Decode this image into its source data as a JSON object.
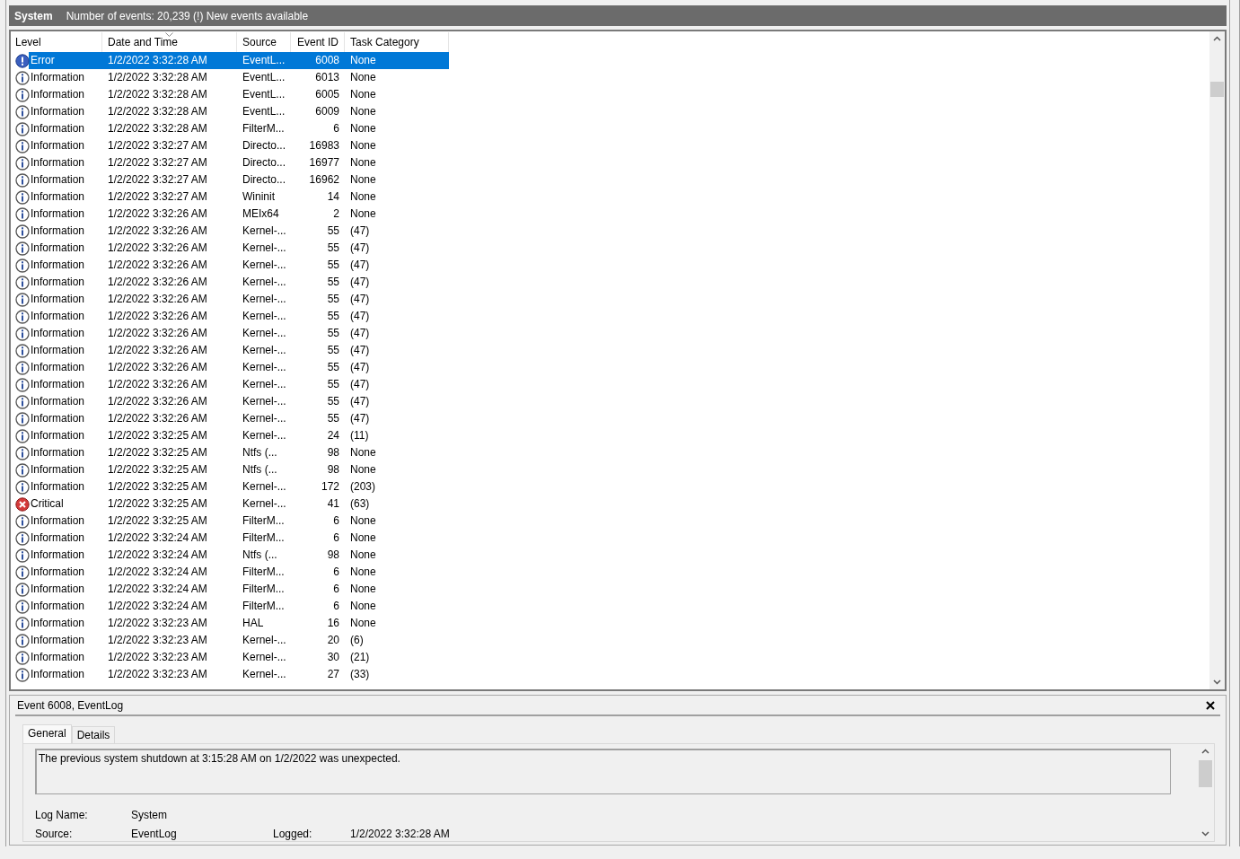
{
  "log_header": {
    "title": "System",
    "info": "Number of events: 20,239 (!) New events available"
  },
  "table": {
    "columns": [
      {
        "label": "Level",
        "sorted": false
      },
      {
        "label": "Date and Time",
        "sorted": true
      },
      {
        "label": "Source",
        "sorted": false
      },
      {
        "label": "Event ID",
        "sorted": false
      },
      {
        "label": "Task Category",
        "sorted": false
      }
    ],
    "rows": [
      {
        "kind": "error",
        "level": "Error",
        "date": "1/2/2022 3:32:28 AM",
        "source": "EventL...",
        "event_id": "6008",
        "category": "None",
        "selected": true
      },
      {
        "kind": "information",
        "level": "Information",
        "date": "1/2/2022 3:32:28 AM",
        "source": "EventL...",
        "event_id": "6013",
        "category": "None",
        "selected": false
      },
      {
        "kind": "information",
        "level": "Information",
        "date": "1/2/2022 3:32:28 AM",
        "source": "EventL...",
        "event_id": "6005",
        "category": "None",
        "selected": false
      },
      {
        "kind": "information",
        "level": "Information",
        "date": "1/2/2022 3:32:28 AM",
        "source": "EventL...",
        "event_id": "6009",
        "category": "None",
        "selected": false
      },
      {
        "kind": "information",
        "level": "Information",
        "date": "1/2/2022 3:32:28 AM",
        "source": "FilterM...",
        "event_id": "6",
        "category": "None",
        "selected": false
      },
      {
        "kind": "information",
        "level": "Information",
        "date": "1/2/2022 3:32:27 AM",
        "source": "Directo...",
        "event_id": "16983",
        "category": "None",
        "selected": false
      },
      {
        "kind": "information",
        "level": "Information",
        "date": "1/2/2022 3:32:27 AM",
        "source": "Directo...",
        "event_id": "16977",
        "category": "None",
        "selected": false
      },
      {
        "kind": "information",
        "level": "Information",
        "date": "1/2/2022 3:32:27 AM",
        "source": "Directo...",
        "event_id": "16962",
        "category": "None",
        "selected": false
      },
      {
        "kind": "information",
        "level": "Information",
        "date": "1/2/2022 3:32:27 AM",
        "source": "Wininit",
        "event_id": "14",
        "category": "None",
        "selected": false
      },
      {
        "kind": "information",
        "level": "Information",
        "date": "1/2/2022 3:32:26 AM",
        "source": "MEIx64",
        "event_id": "2",
        "category": "None",
        "selected": false
      },
      {
        "kind": "information",
        "level": "Information",
        "date": "1/2/2022 3:32:26 AM",
        "source": "Kernel-...",
        "event_id": "55",
        "category": "(47)",
        "selected": false
      },
      {
        "kind": "information",
        "level": "Information",
        "date": "1/2/2022 3:32:26 AM",
        "source": "Kernel-...",
        "event_id": "55",
        "category": "(47)",
        "selected": false
      },
      {
        "kind": "information",
        "level": "Information",
        "date": "1/2/2022 3:32:26 AM",
        "source": "Kernel-...",
        "event_id": "55",
        "category": "(47)",
        "selected": false
      },
      {
        "kind": "information",
        "level": "Information",
        "date": "1/2/2022 3:32:26 AM",
        "source": "Kernel-...",
        "event_id": "55",
        "category": "(47)",
        "selected": false
      },
      {
        "kind": "information",
        "level": "Information",
        "date": "1/2/2022 3:32:26 AM",
        "source": "Kernel-...",
        "event_id": "55",
        "category": "(47)",
        "selected": false
      },
      {
        "kind": "information",
        "level": "Information",
        "date": "1/2/2022 3:32:26 AM",
        "source": "Kernel-...",
        "event_id": "55",
        "category": "(47)",
        "selected": false
      },
      {
        "kind": "information",
        "level": "Information",
        "date": "1/2/2022 3:32:26 AM",
        "source": "Kernel-...",
        "event_id": "55",
        "category": "(47)",
        "selected": false
      },
      {
        "kind": "information",
        "level": "Information",
        "date": "1/2/2022 3:32:26 AM",
        "source": "Kernel-...",
        "event_id": "55",
        "category": "(47)",
        "selected": false
      },
      {
        "kind": "information",
        "level": "Information",
        "date": "1/2/2022 3:32:26 AM",
        "source": "Kernel-...",
        "event_id": "55",
        "category": "(47)",
        "selected": false
      },
      {
        "kind": "information",
        "level": "Information",
        "date": "1/2/2022 3:32:26 AM",
        "source": "Kernel-...",
        "event_id": "55",
        "category": "(47)",
        "selected": false
      },
      {
        "kind": "information",
        "level": "Information",
        "date": "1/2/2022 3:32:26 AM",
        "source": "Kernel-...",
        "event_id": "55",
        "category": "(47)",
        "selected": false
      },
      {
        "kind": "information",
        "level": "Information",
        "date": "1/2/2022 3:32:26 AM",
        "source": "Kernel-...",
        "event_id": "55",
        "category": "(47)",
        "selected": false
      },
      {
        "kind": "information",
        "level": "Information",
        "date": "1/2/2022 3:32:25 AM",
        "source": "Kernel-...",
        "event_id": "24",
        "category": "(11)",
        "selected": false
      },
      {
        "kind": "information",
        "level": "Information",
        "date": "1/2/2022 3:32:25 AM",
        "source": "Ntfs (...",
        "event_id": "98",
        "category": "None",
        "selected": false
      },
      {
        "kind": "information",
        "level": "Information",
        "date": "1/2/2022 3:32:25 AM",
        "source": "Ntfs (...",
        "event_id": "98",
        "category": "None",
        "selected": false
      },
      {
        "kind": "information",
        "level": "Information",
        "date": "1/2/2022 3:32:25 AM",
        "source": "Kernel-...",
        "event_id": "172",
        "category": "(203)",
        "selected": false
      },
      {
        "kind": "critical",
        "level": "Critical",
        "date": "1/2/2022 3:32:25 AM",
        "source": "Kernel-...",
        "event_id": "41",
        "category": "(63)",
        "selected": false
      },
      {
        "kind": "information",
        "level": "Information",
        "date": "1/2/2022 3:32:25 AM",
        "source": "FilterM...",
        "event_id": "6",
        "category": "None",
        "selected": false
      },
      {
        "kind": "information",
        "level": "Information",
        "date": "1/2/2022 3:32:24 AM",
        "source": "FilterM...",
        "event_id": "6",
        "category": "None",
        "selected": false
      },
      {
        "kind": "information",
        "level": "Information",
        "date": "1/2/2022 3:32:24 AM",
        "source": "Ntfs (...",
        "event_id": "98",
        "category": "None",
        "selected": false
      },
      {
        "kind": "information",
        "level": "Information",
        "date": "1/2/2022 3:32:24 AM",
        "source": "FilterM...",
        "event_id": "6",
        "category": "None",
        "selected": false
      },
      {
        "kind": "information",
        "level": "Information",
        "date": "1/2/2022 3:32:24 AM",
        "source": "FilterM...",
        "event_id": "6",
        "category": "None",
        "selected": false
      },
      {
        "kind": "information",
        "level": "Information",
        "date": "1/2/2022 3:32:24 AM",
        "source": "FilterM...",
        "event_id": "6",
        "category": "None",
        "selected": false
      },
      {
        "kind": "information",
        "level": "Information",
        "date": "1/2/2022 3:32:23 AM",
        "source": "HAL",
        "event_id": "16",
        "category": "None",
        "selected": false
      },
      {
        "kind": "information",
        "level": "Information",
        "date": "1/2/2022 3:32:23 AM",
        "source": "Kernel-...",
        "event_id": "20",
        "category": "(6)",
        "selected": false
      },
      {
        "kind": "information",
        "level": "Information",
        "date": "1/2/2022 3:32:23 AM",
        "source": "Kernel-...",
        "event_id": "30",
        "category": "(21)",
        "selected": false
      },
      {
        "kind": "information",
        "level": "Information",
        "date": "1/2/2022 3:32:23 AM",
        "source": "Kernel-...",
        "event_id": "27",
        "category": "(33)",
        "selected": false
      }
    ]
  },
  "details": {
    "title": "Event 6008, EventLog",
    "tabs": [
      {
        "label": "General",
        "selected": true
      },
      {
        "label": "Details",
        "selected": false
      }
    ],
    "description": "The previous system shutdown at 3:15:28 AM on 1/2/2022 was unexpected.",
    "fields": [
      [
        {
          "label": "Log Name:",
          "value": "System"
        }
      ],
      [
        {
          "label": "Source:",
          "value": "EventLog"
        },
        {
          "label": "Logged:",
          "value": "1/2/2022 3:32:28 AM"
        }
      ]
    ]
  }
}
